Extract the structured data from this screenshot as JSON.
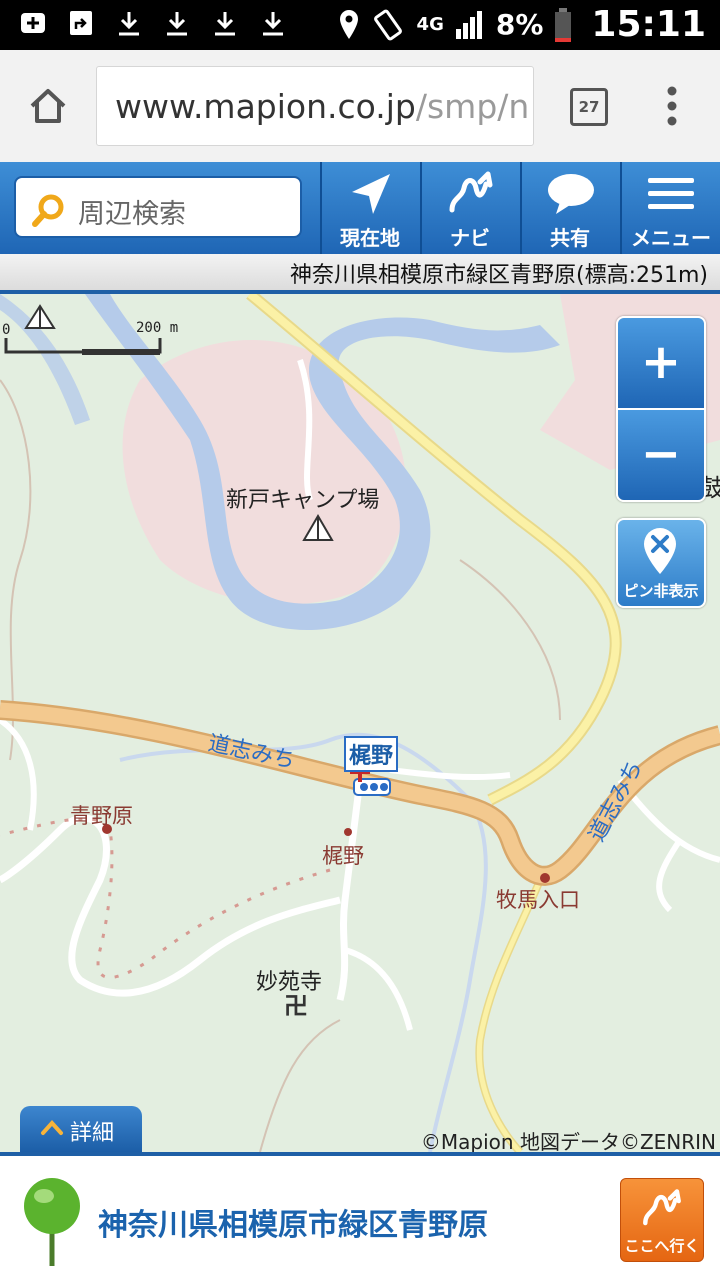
{
  "status_bar": {
    "battery": "8%",
    "time": "15:11",
    "network": "4G"
  },
  "browser": {
    "url_visible": "www.mapion.co.jp",
    "url_faded": "/smp/n",
    "tab_count": "27"
  },
  "toolbar": {
    "search_placeholder": "周辺検索",
    "buttons": [
      {
        "label": "現在地",
        "icon": "arrow-location-icon"
      },
      {
        "label": "ナビ",
        "icon": "route-icon"
      },
      {
        "label": "共有",
        "icon": "speech-bubble-icon"
      },
      {
        "label": "メニュー",
        "icon": "hamburger-icon"
      }
    ]
  },
  "address_bar": "神奈川県相模原市緑区青野原(標高:251m)",
  "map": {
    "scale": {
      "left": "0",
      "right": "200 m"
    },
    "labels": {
      "camp": "新戸キャンプ場",
      "road_left": "道志みち",
      "road_right": "道志みち",
      "bus_stop": "梶野",
      "place_aonohara": "青野原",
      "place_kajino": "梶野",
      "place_bokuba": "牧馬入口",
      "temple": "妙苑寺",
      "edge_char": "鼓"
    },
    "zoom_in": "+",
    "zoom_out": "−",
    "pin_toggle": "ピン非表示",
    "copyright": "©Mapion 地図データ©ZENRIN",
    "colors": {
      "land": "#e3eee0",
      "built_area": "#f1dddd",
      "water": "#b5cbea",
      "main_road": "#f3c98f",
      "secondary_road": "#fbf1a6"
    }
  },
  "detail_tab": "詳細",
  "bottom_panel": {
    "place_name": "神奈川県相模原市緑区青野原",
    "goto_label": "ここへ行く"
  }
}
